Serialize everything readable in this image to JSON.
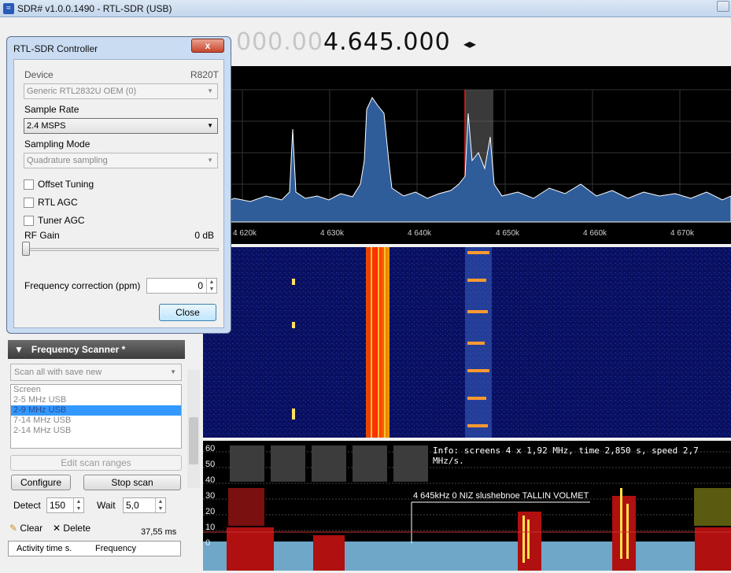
{
  "window": {
    "title": "SDR# v1.0.0.1490 - RTL-SDR (USB)"
  },
  "frequency": {
    "dim": "000.00",
    "bright": "4.645.000",
    "arrows": "◂▸"
  },
  "spectrum": {
    "axis_labels": [
      "4 620k",
      "4 630k",
      "4 640k",
      "4 650k",
      "4 660k",
      "4 670k"
    ]
  },
  "scanner_view": {
    "info": "Info: screens 4 x 1,92 MHz, time 2,850 s, speed 2,7 MHz/s.",
    "annotation": "4 645kHz 0 NIZ slushebnoe TALLIN VOLMET",
    "y_labels": [
      "60",
      "50",
      "40",
      "30",
      "20",
      "10",
      "0"
    ]
  },
  "dialog": {
    "title": "RTL-SDR Controller",
    "close_x": "x",
    "device_label": "Device",
    "device_tuner": "R820T",
    "device_value": "Generic RTL2832U OEM (0)",
    "sample_rate_label": "Sample Rate",
    "sample_rate_value": "2.4 MSPS",
    "sampling_mode_label": "Sampling Mode",
    "sampling_mode_value": "Quadrature sampling",
    "offset_tuning": "Offset Tuning",
    "rtl_agc": "RTL AGC",
    "tuner_agc": "Tuner AGC",
    "rf_gain_label": "RF Gain",
    "rf_gain_value": "0 dB",
    "freq_corr_label": "Frequency correction (ppm)",
    "freq_corr_value": "0",
    "close_button": "Close"
  },
  "freq_scanner": {
    "header": "Frequency Scanner *",
    "mode": "Scan all with save new",
    "ranges": [
      "Screen",
      "2-5 MHz USB",
      "2-9 MHz USB",
      "7-14 MHz USB",
      "2-14 MHz USB"
    ],
    "edit_ranges": "Edit scan ranges",
    "configure": "Configure",
    "stop_scan": "Stop scan",
    "detect_label": "Detect",
    "detect_value": "150",
    "wait_label": "Wait",
    "wait_value": "5,0",
    "clear": "Clear",
    "delete": "Delete",
    "timing": "37,55 ms",
    "col_activity": "Activity time s.",
    "col_frequency": "Frequency"
  },
  "colors": {
    "spectrum_fill": "#2f5d9a",
    "waterfall_bg": "#0a1060",
    "peak_red": "#e02020",
    "peak_yellow": "#ffe14a"
  }
}
